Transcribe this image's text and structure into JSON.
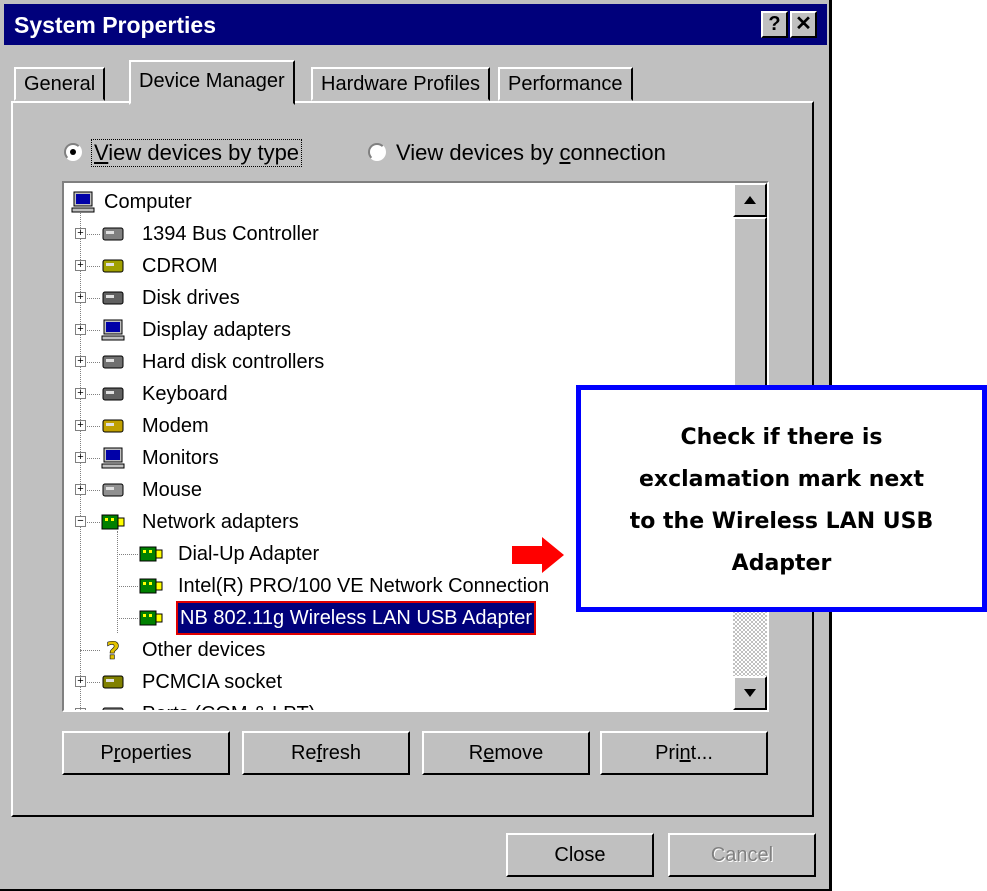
{
  "window": {
    "title": "System Properties",
    "help_label": "?",
    "close_label": "✕"
  },
  "tabs": [
    {
      "label": "General",
      "active": false
    },
    {
      "label": "Device Manager",
      "active": true
    },
    {
      "label": "Hardware Profiles",
      "active": false
    },
    {
      "label": "Performance",
      "active": false
    }
  ],
  "view_options": {
    "by_type": {
      "pre": "",
      "underlined": "V",
      "post": "iew devices by type",
      "selected": true
    },
    "by_connection": {
      "pre": "View devices by ",
      "underlined": "c",
      "post": "onnection",
      "selected": false
    }
  },
  "devices": [
    {
      "label": "Computer",
      "icon": "computer-icon",
      "level": 0
    },
    {
      "label": "1394 Bus Controller",
      "icon": "bus-controller-icon",
      "level": 1,
      "expander": "+"
    },
    {
      "label": "CDROM",
      "icon": "cdrom-icon",
      "level": 1,
      "expander": "+"
    },
    {
      "label": "Disk drives",
      "icon": "disk-drive-icon",
      "level": 1,
      "expander": "+"
    },
    {
      "label": "Display adapters",
      "icon": "display-adapter-icon",
      "level": 1,
      "expander": "+"
    },
    {
      "label": "Hard disk controllers",
      "icon": "hard-disk-controller-icon",
      "level": 1,
      "expander": "+"
    },
    {
      "label": "Keyboard",
      "icon": "keyboard-icon",
      "level": 1,
      "expander": "+"
    },
    {
      "label": "Modem",
      "icon": "modem-icon",
      "level": 1,
      "expander": "+"
    },
    {
      "label": "Monitors",
      "icon": "monitor-icon",
      "level": 1,
      "expander": "+"
    },
    {
      "label": "Mouse",
      "icon": "mouse-icon",
      "level": 1,
      "expander": "+"
    },
    {
      "label": "Network adapters",
      "icon": "network-adapter-icon",
      "level": 1,
      "expander": "−"
    },
    {
      "label": "Dial-Up Adapter",
      "icon": "network-adapter-icon",
      "level": 2
    },
    {
      "label": "Intel(R) PRO/100 VE Network Connection",
      "icon": "network-adapter-icon",
      "level": 2
    },
    {
      "label": "NB 802.11g Wireless LAN USB Adapter",
      "icon": "network-adapter-icon",
      "level": 2,
      "selected": true
    },
    {
      "label": "Other devices",
      "icon": "question-icon",
      "level": 1
    },
    {
      "label": "PCMCIA socket",
      "icon": "pcmcia-icon",
      "level": 1,
      "expander": "+"
    },
    {
      "label": "Ports (COM & LPT)",
      "icon": "port-icon",
      "level": 1,
      "expander": "+"
    }
  ],
  "buttons": {
    "properties": {
      "pre": "P",
      "underlined": "r",
      "post": "operties"
    },
    "refresh": {
      "pre": "Re",
      "underlined": "f",
      "post": "resh"
    },
    "remove": {
      "pre": "R",
      "underlined": "e",
      "post": "move"
    },
    "print": {
      "pre": "Pri",
      "underlined": "n",
      "post": "t..."
    },
    "close": "Close",
    "cancel": "Cancel"
  },
  "callout": {
    "lines": [
      "Check if there is",
      "exclamation mark next",
      "to the Wireless LAN USB",
      "Adapter"
    ]
  },
  "colors": {
    "titlebar": "#00007b",
    "selection": "#00007b",
    "callout_border": "#0000ff",
    "arrow": "#ff0000",
    "highlight_outline": "#e00000"
  }
}
